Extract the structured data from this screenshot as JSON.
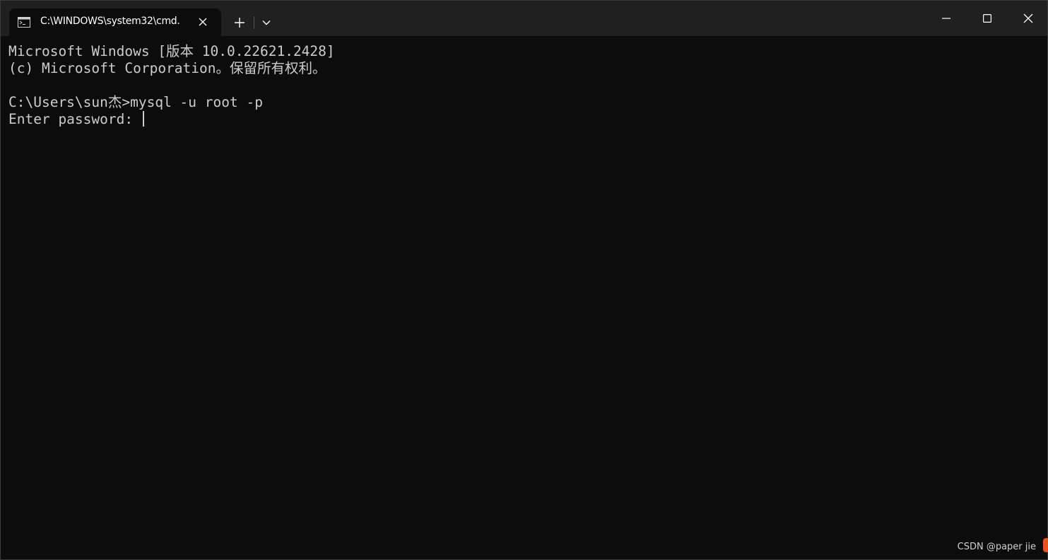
{
  "tab": {
    "title": "C:\\WINDOWS\\system32\\cmd.",
    "icon": "cmd-terminal-icon"
  },
  "tabbar": {
    "new_tab_icon": "plus-icon",
    "dropdown_icon": "chevron-down-icon"
  },
  "window_controls": [
    "minimize-icon",
    "maximize-icon",
    "close-icon"
  ],
  "terminal": {
    "lines": [
      "Microsoft Windows [版本 10.0.22621.2428]",
      "(c) Microsoft Corporation。保留所有权利。",
      "",
      "C:\\Users\\sun杰>mysql -u root -p",
      "Enter password: "
    ]
  },
  "watermark": "CSDN @paper jie",
  "colors": {
    "background": "#0c0c0c",
    "titlebar": "#202020",
    "text": "#cccccc",
    "accent": "#e8541e"
  }
}
